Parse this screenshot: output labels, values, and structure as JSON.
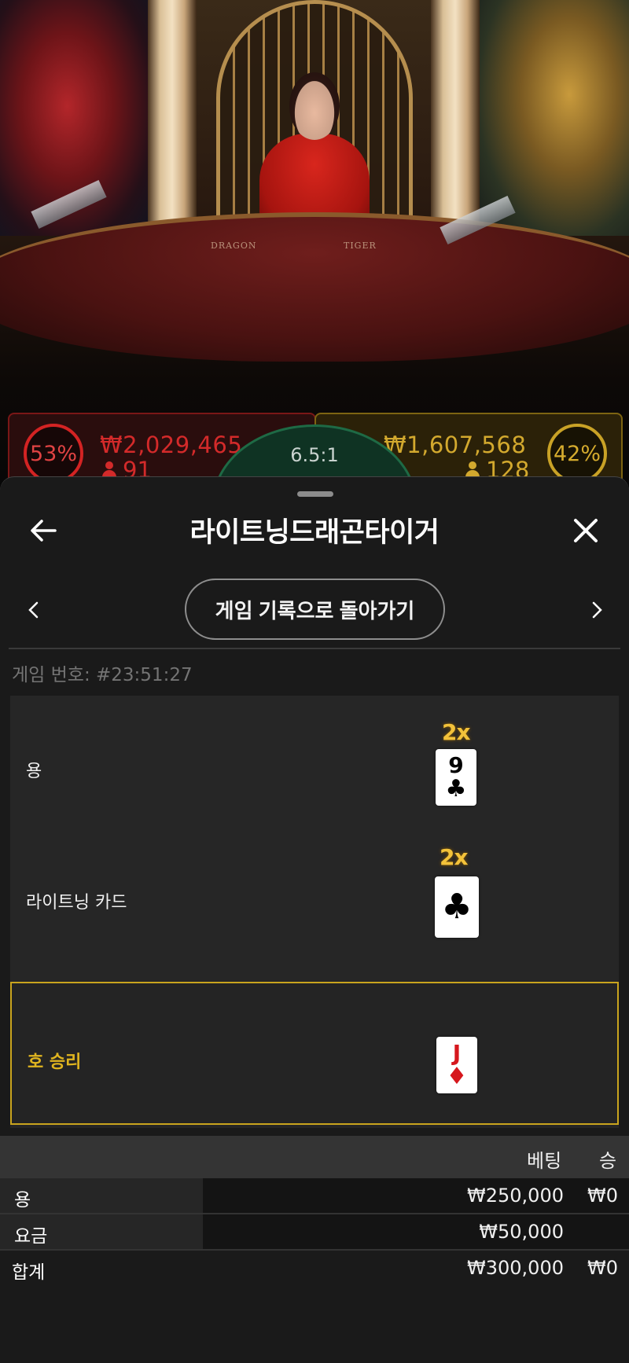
{
  "game_stage": {
    "table_labels": {
      "dragon": "DRAGON",
      "tiger": "TIGER"
    },
    "dragon_bets": {
      "percent": "53%",
      "amount": "₩2,029,465",
      "players": "91"
    },
    "tiger_bets": {
      "percent": "42%",
      "amount": "₩1,607,568",
      "players": "128"
    },
    "tie_odds": "6.5:1",
    "colors": {
      "dragon": "#d32323",
      "tiger": "#c9a226",
      "tie": "#1e6a45"
    }
  },
  "sheet": {
    "title": "라이트닝드래곤타이거",
    "back_icon": "arrow-left-icon",
    "close_icon": "close-icon",
    "back_to_history": "게임 기록으로 돌아가기",
    "game_number": "게임 번호: #23:51:27",
    "results": [
      {
        "label": "용",
        "multiplier": "2x",
        "card_rank": "9",
        "card_suit": "♣",
        "suit_color": "black"
      },
      {
        "label": "라이트닝 카드",
        "multiplier": "2x",
        "card_rank": "",
        "card_suit": "♣",
        "suit_color": "black"
      },
      {
        "label": "호 승리",
        "multiplier": "",
        "card_rank": "J",
        "card_suit": "♦",
        "suit_color": "red",
        "winner": true
      }
    ],
    "table": {
      "headers": {
        "bet": "베팅",
        "win": "승"
      },
      "rows": [
        {
          "label": "용",
          "bet": "₩250,000",
          "win": "₩0"
        },
        {
          "label": "요금",
          "bet": "₩50,000",
          "win": ""
        }
      ],
      "total": {
        "label": "합계",
        "bet": "₩300,000",
        "win": "₩0"
      }
    },
    "accent_color": "#c9a41e"
  }
}
